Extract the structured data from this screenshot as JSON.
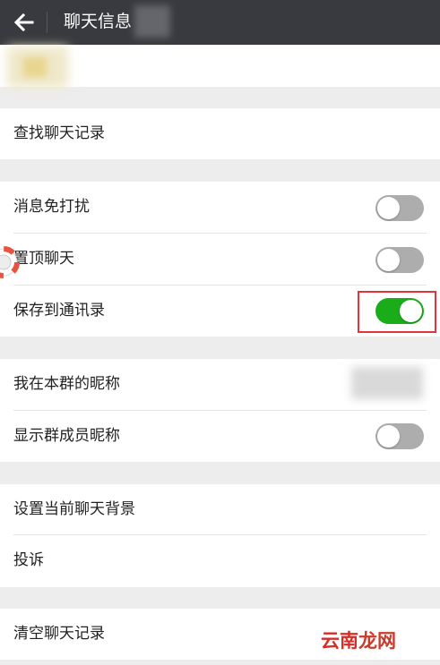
{
  "header": {
    "title": "聊天信息",
    "back_icon": "arrow-left-icon"
  },
  "rows": {
    "search_history": "查找聊天记录",
    "mute": "消息免打扰",
    "pin": "置顶聊天",
    "save_contacts": "保存到通讯录",
    "my_nickname": "我在本群的昵称",
    "show_nicknames": "显示群成员昵称",
    "set_background": "设置当前聊天背景",
    "report": "投诉",
    "clear_history": "清空聊天记录"
  },
  "toggles": {
    "mute": false,
    "pin": false,
    "save_contacts": true,
    "show_nicknames": false
  },
  "colors": {
    "header_bg": "#393a3f",
    "toggle_on": "#1aad19",
    "toggle_off": "#adadad",
    "highlight_box": "#e5333b"
  },
  "watermark": {
    "part1": "云南",
    "part2": "龙网"
  }
}
